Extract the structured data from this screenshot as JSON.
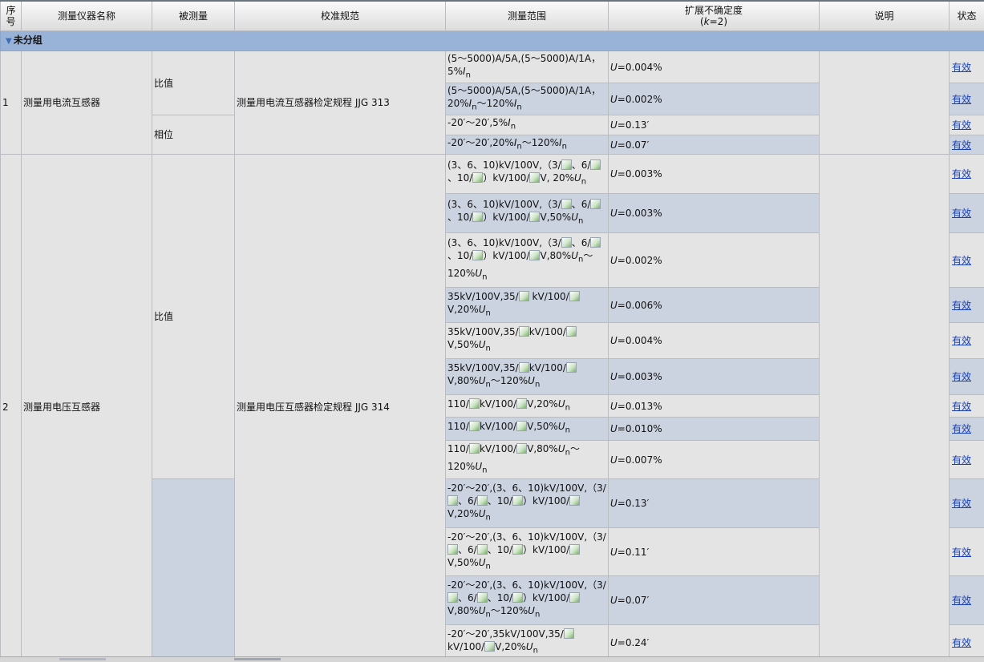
{
  "columns": {
    "index": "序号",
    "name": "测量仪器名称",
    "measurand": "被测量",
    "spec": "校准规范",
    "range": "测量范围",
    "uncertainty": "扩展不确定度",
    "uncertainty_sub": "(k=2)",
    "note": "说明",
    "status": "状态"
  },
  "group": {
    "label": "未分组",
    "icon": "triangle-down-icon"
  },
  "broken_image_icon": "broken-image-icon",
  "rows": [
    {
      "id": "r1",
      "range": "(5～5000)A/5A,(5～5000)A/1A，5%In",
      "uncertainty": "U=0.004%",
      "status": "有效"
    },
    {
      "id": "r2",
      "range": "(5～5000)A/5A,(5～5000)A/1A，20%In～120%In",
      "uncertainty": "U=0.002%",
      "status": "有效"
    },
    {
      "id": "r3",
      "range": "-20′～20′,5%In",
      "uncertainty": "U=0.13′",
      "status": "有效"
    },
    {
      "id": "r4",
      "range": "-20′～20′,20%In～120%In",
      "uncertainty": "U=0.07′",
      "status": "有效"
    },
    {
      "id": "r5",
      "range": "(3、6、10)kV/100V,（3/、6/、10/）kV/100/V, 20%Un",
      "uncertainty": "U=0.003%",
      "status": "有效"
    },
    {
      "id": "r6",
      "range": "(3、6、10)kV/100V,（3/、6/、10/）kV/100/V,50%Un",
      "uncertainty": "U=0.003%",
      "status": "有效"
    },
    {
      "id": "r7",
      "range": "(3、6、10)kV/100V,（3/、6/、10/）kV/100/V,80%Un～120%Un",
      "uncertainty": "U=0.002%",
      "status": "有效"
    },
    {
      "id": "r8",
      "range": "35kV/100V,35/ kV/100/V,20%Un",
      "uncertainty": "U=0.006%",
      "status": "有效"
    },
    {
      "id": "r9",
      "range": "35kV/100V,35/kV/100/V,50%Un",
      "uncertainty": "U=0.004%",
      "status": "有效"
    },
    {
      "id": "r10",
      "range": "35kV/100V,35/kV/100/V,80%Un～120%Un",
      "uncertainty": "U=0.003%",
      "status": "有效"
    },
    {
      "id": "r11",
      "range": "110/kV/100/V,20%Un",
      "uncertainty": "U=0.013%",
      "status": "有效"
    },
    {
      "id": "r12",
      "range": "110/kV/100/V,50%Un",
      "uncertainty": "U=0.010%",
      "status": "有效"
    },
    {
      "id": "r13",
      "range": "110/kV/100/V,80%Un～120%Un",
      "uncertainty": "U=0.007%",
      "status": "有效"
    },
    {
      "id": "r14",
      "range": "-20′～20′,(3、6、10)kV/100V,（3/、6/、10/）kV/100/V,20%Un",
      "uncertainty": "U=0.13′",
      "status": "有效"
    },
    {
      "id": "r15",
      "range": "-20′～20′,(3、6、10)kV/100V,（3/、6/、10/）kV/100/V,50%Un",
      "uncertainty": "U=0.11′",
      "status": "有效"
    },
    {
      "id": "r16",
      "range": "-20′～20′,(3、6、10)kV/100V,（3/、6/、10/）kV/100/V,80%Un～120%Un",
      "uncertainty": "U=0.07′",
      "status": "有效"
    },
    {
      "id": "r17",
      "range": "-20′～20′,35kV/100V,35/kV/100/V,20%Un",
      "uncertainty": "U=0.24′",
      "status": "有效"
    }
  ],
  "instruments": [
    {
      "index": "1",
      "name": "测量用电流互感器",
      "spec": "测量用电流互感器检定规程 JJG 313",
      "measurands": {
        "ratio": "比值",
        "phase": "相位"
      }
    },
    {
      "index": "2",
      "name": "测量用电压互感器",
      "spec": "测量用电压互感器检定规程 JJG 314",
      "measurands": {
        "ratio": "比值"
      }
    }
  ]
}
